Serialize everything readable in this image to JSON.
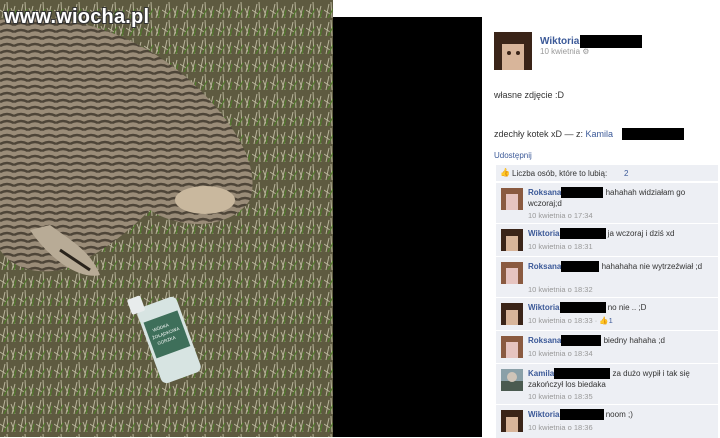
{
  "watermark": "www.wiocha.pl",
  "bottle_label": [
    "WÓDKA",
    "ŻOŁĄDKOWA",
    "GORZKA"
  ],
  "post": {
    "owner_name": "Wiktoria",
    "timestamp": "10 kwietnia",
    "caption": "własne zdjęcie :D",
    "description": "zdechły kotek xD — z:",
    "tagged_name": "Kamila",
    "share_label": "Udostępnij"
  },
  "likes": {
    "label": "Liczba osób, które to lubią:",
    "count": "2"
  },
  "comments": [
    {
      "author": "Roksana",
      "text": "hahahah widziałam go wczoraj;d",
      "time": "10 kwietnia o 17:34",
      "likes": ""
    },
    {
      "author": "Wiktoria",
      "text": "ja wczoraj i dziś xd",
      "time": "10 kwietnia o 18:31",
      "likes": ""
    },
    {
      "author": "Roksana",
      "text": "hahahaha nie wytrzeźwiał ;d",
      "time": "10 kwietnia o 18:32",
      "likes": ""
    },
    {
      "author": "Wiktoria",
      "text": "no nie .. ;D",
      "time": "10 kwietnia o 18:33 ·",
      "likes": "1"
    },
    {
      "author": "Roksana",
      "text": "biedny hahaha ;d",
      "time": "10 kwietnia o 18:34",
      "likes": ""
    },
    {
      "author": "Kamila",
      "text": "za dużo wypił i tak się zakończył los biedaka",
      "time": "10 kwietnia o 18:35",
      "likes": ""
    },
    {
      "author": "Wiktoria",
      "text": "noom ;)",
      "time": "10 kwietnia o 18:36",
      "likes": ""
    }
  ],
  "colors": {
    "link": "#3b5998",
    "comment_bg": "#edeff4",
    "timestamp": "#999999"
  }
}
